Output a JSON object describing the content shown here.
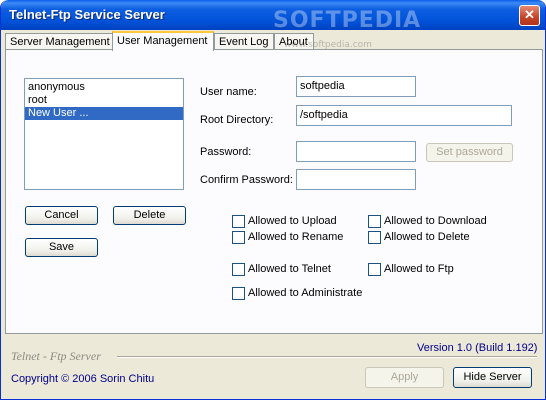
{
  "window": {
    "title": "Telnet-Ftp Service Server",
    "close_glyph": "✕",
    "watermark": "SOFTPEDIA",
    "watermark_url": "www.softpedia.com"
  },
  "tabs": [
    {
      "label": "Server Management",
      "active": false
    },
    {
      "label": "User Management",
      "active": true
    },
    {
      "label": "Event Log",
      "active": false
    },
    {
      "label": "About",
      "active": false
    }
  ],
  "users": {
    "items": [
      "anonymous",
      "root",
      "New User ..."
    ],
    "selected_index": 2
  },
  "buttons": {
    "cancel": "Cancel",
    "delete": "Delete",
    "save": "Save",
    "set_password": "Set password",
    "apply": "Apply",
    "hide_server": "Hide Server"
  },
  "form": {
    "username_label": "User name:",
    "username_value": "softpedia",
    "rootdir_label": "Root Directory:",
    "rootdir_value": "/softpedia",
    "password_label": "Password:",
    "password_value": "",
    "confirm_label": "Confirm Password:",
    "confirm_value": ""
  },
  "permissions": [
    {
      "label": "Allowed to Upload",
      "checked": false
    },
    {
      "label": "Allowed to Download",
      "checked": false
    },
    {
      "label": "Allowed to Rename",
      "checked": false
    },
    {
      "label": "Allowed to Delete",
      "checked": false
    },
    {
      "label": "Allowed to Telnet",
      "checked": false
    },
    {
      "label": "Allowed to Ftp",
      "checked": false
    },
    {
      "label": "Allowed to Administrate",
      "checked": false
    }
  ],
  "footer": {
    "app_name": "Telnet - Ftp Server",
    "version": "Version 1.0 (Build 1.192)",
    "copyright": "Copyright © 2006 Sorin Chitu"
  },
  "colors": {
    "title_bar": "#0054e3",
    "selection": "#316ac5",
    "link_text": "#00008b",
    "active_tab_accent": "#ffc73c"
  }
}
